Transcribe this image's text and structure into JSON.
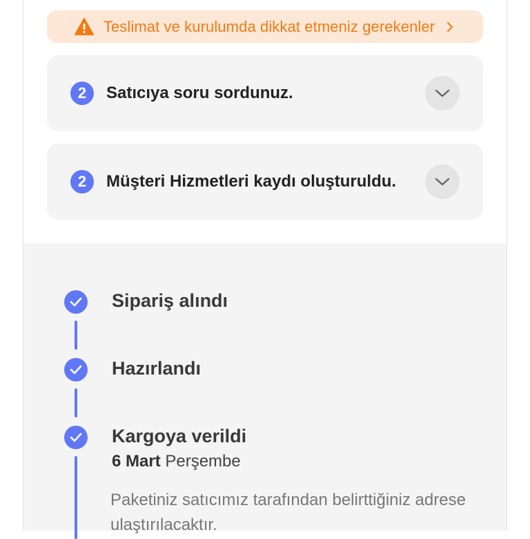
{
  "warning": {
    "text": "Teslimat ve kurulumda dikkat etmeniz gerekenler",
    "icon": "warning-triangle-icon",
    "color": "#f07b13"
  },
  "cards": [
    {
      "count": "2",
      "title": "Satıcıya soru sordunuz."
    },
    {
      "count": "2",
      "title": "Müşteri Hizmetleri kaydı oluşturuldu."
    }
  ],
  "timeline": {
    "accent": "#6178f5",
    "steps": [
      {
        "title": "Sipariş alındı"
      },
      {
        "title": "Hazırlandı"
      },
      {
        "title": "Kargoya verildi",
        "date_day": "6 Mart",
        "date_weekday": "Perşembe",
        "description": "Paketiniz satıcımız tarafından belirttiğiniz adrese ulaştırılacaktır."
      }
    ]
  }
}
